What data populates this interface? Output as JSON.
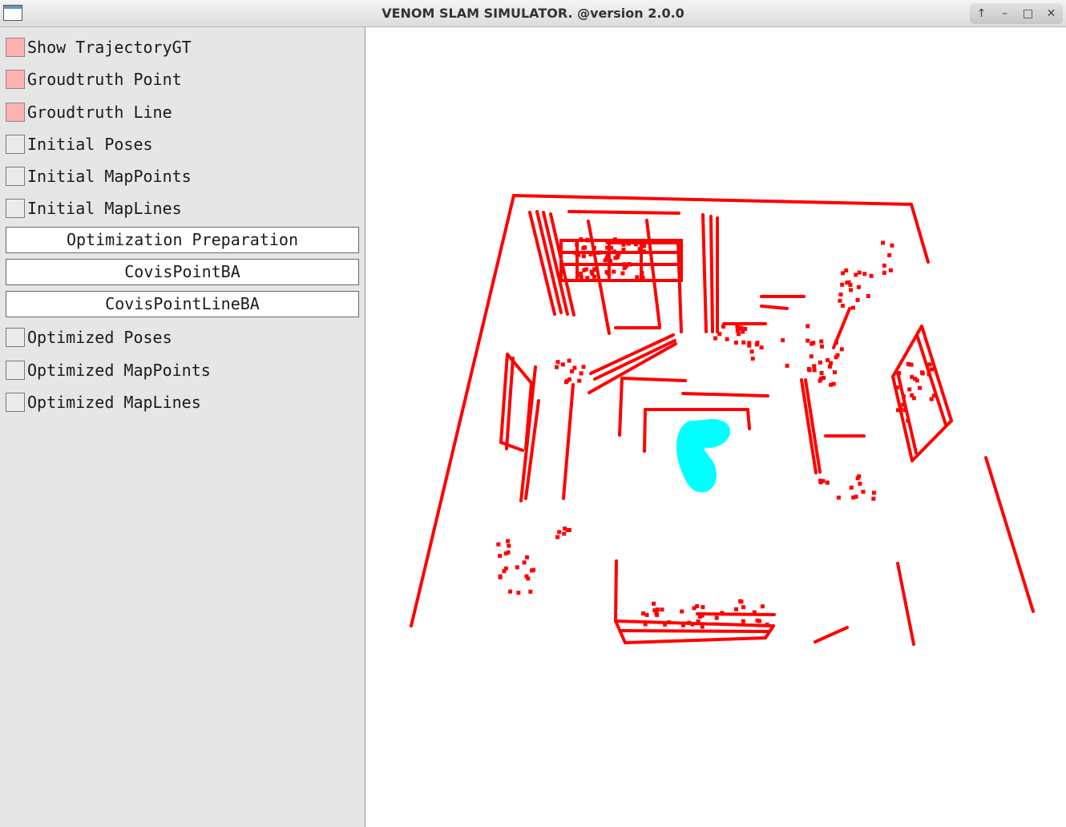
{
  "window": {
    "title": "VENOM SLAM SIMULATOR. @version 2.0.0",
    "controls": [
      "up-arrow-icon",
      "minimize-icon",
      "maximize-icon",
      "close-icon"
    ]
  },
  "panel": {
    "toggles_top": [
      {
        "label": "Show TrajectoryGT",
        "checked": true
      },
      {
        "label": "Groudtruth Point",
        "checked": true
      },
      {
        "label": "Groudtruth Line",
        "checked": true
      },
      {
        "label": "Initial Poses",
        "checked": false
      },
      {
        "label": "Initial MapPoints",
        "checked": false
      },
      {
        "label": "Initial MapLines",
        "checked": false
      }
    ],
    "buttons": [
      {
        "label": "Optimization Preparation"
      },
      {
        "label": "CovisPointBA"
      },
      {
        "label": "CovisPointLineBA"
      }
    ],
    "toggles_bottom": [
      {
        "label": "Optimized Poses",
        "checked": false
      },
      {
        "label": "Optimized MapPoints",
        "checked": false
      },
      {
        "label": "Optimized MapLines",
        "checked": false
      }
    ]
  },
  "viewport": {
    "groundtruth_color": "#ff0000",
    "trajectory_color": "#00ffff",
    "background": "#ffffff"
  }
}
